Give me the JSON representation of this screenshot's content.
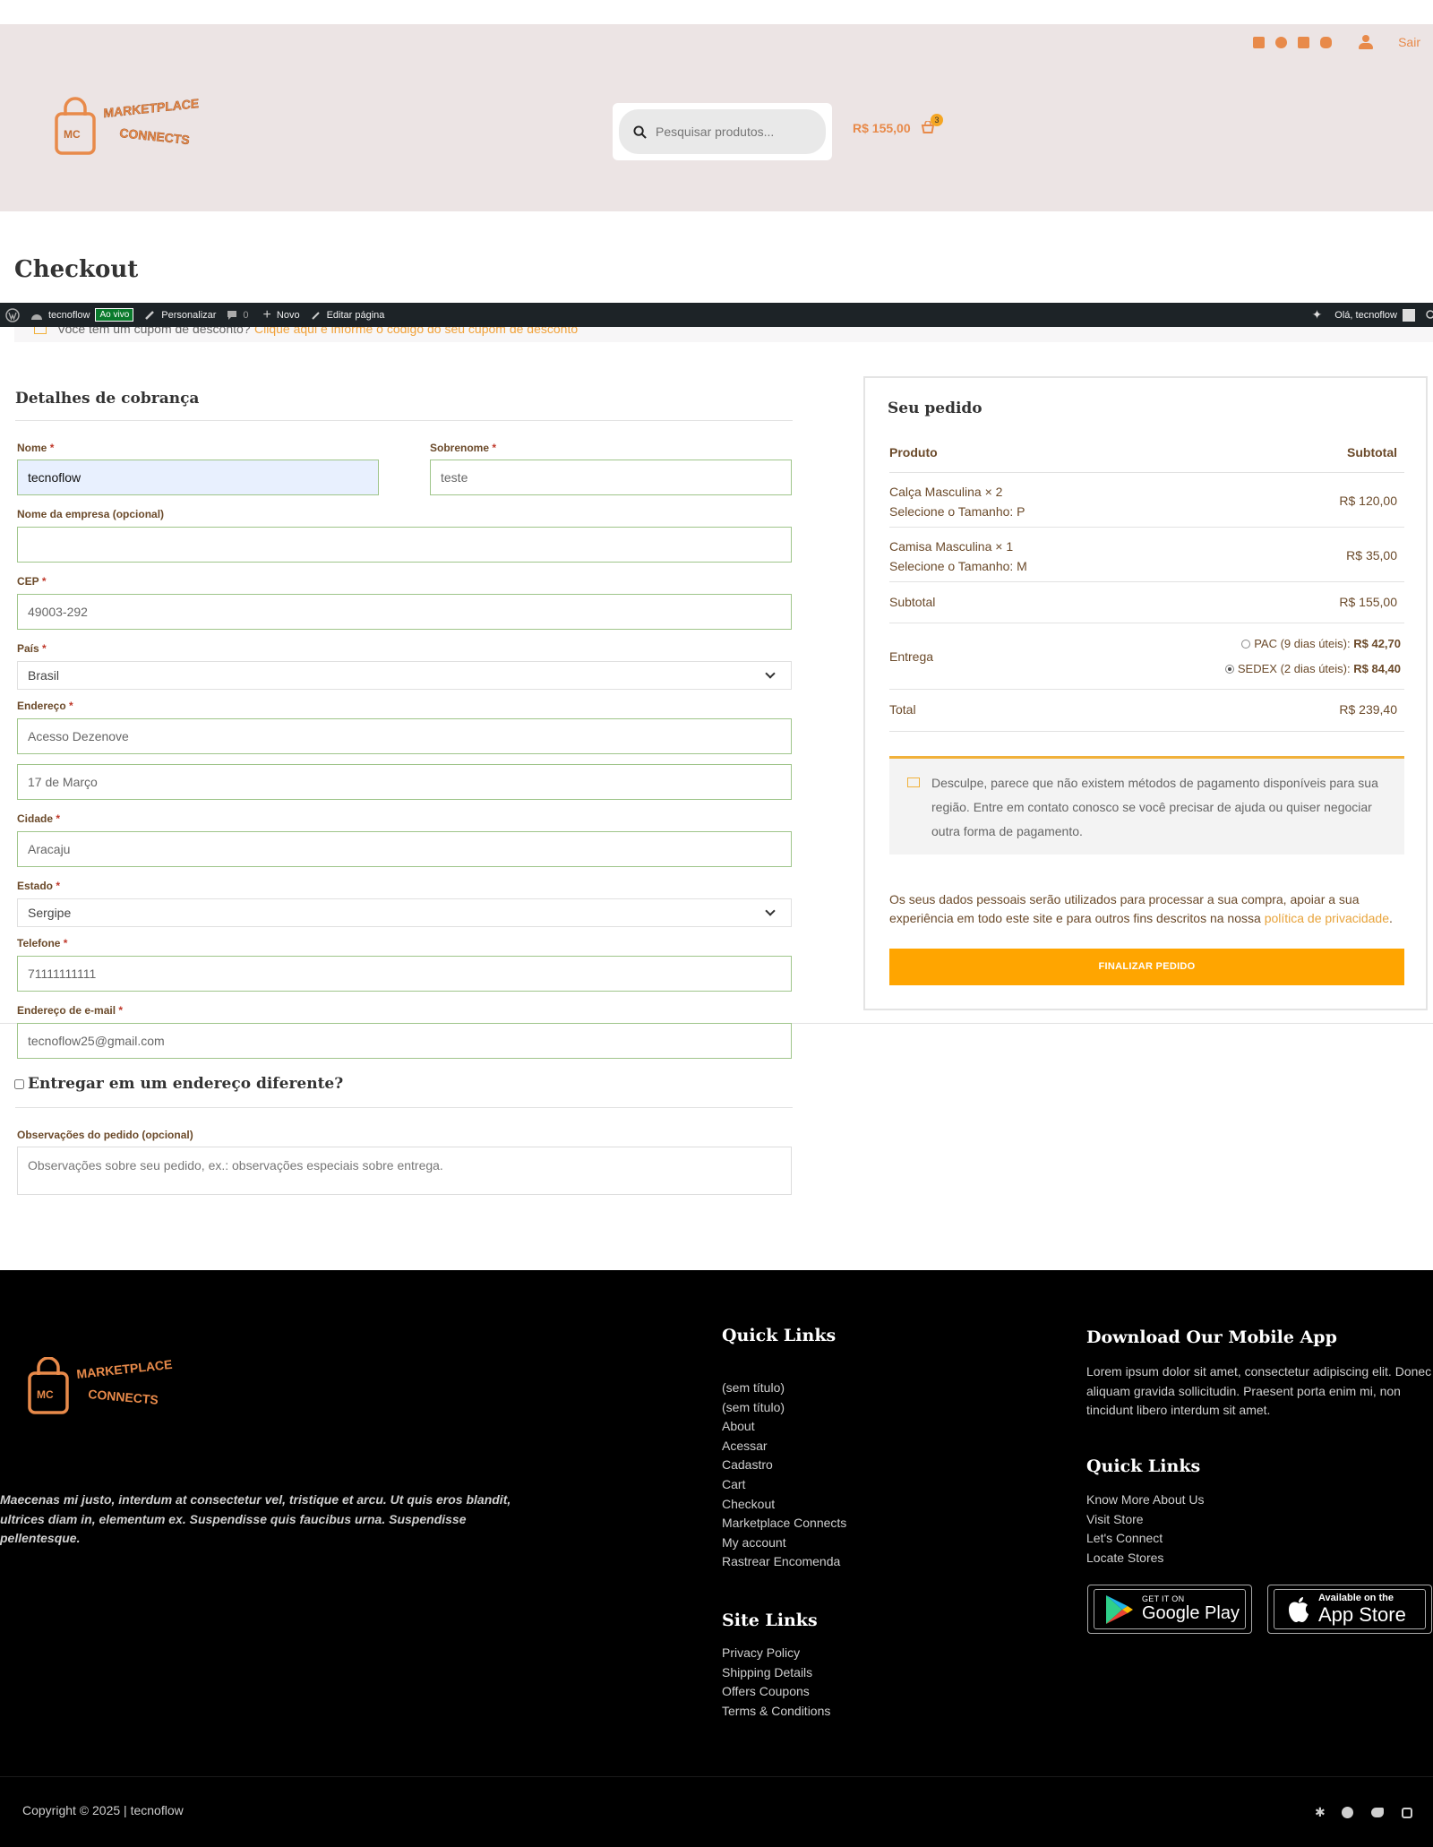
{
  "header": {
    "logout": "Sair",
    "search_placeholder": "Pesquisar produtos...",
    "cart_total": "R$ 155,00",
    "cart_count": "3",
    "logo_line1": "MARKETPLACE",
    "logo_line2": "CONNECTS",
    "logo_mark": "MC"
  },
  "page_title": "Checkout",
  "admin_bar": {
    "site": "tecnoflow",
    "live": "Ao vivo",
    "customize": "Personalizar",
    "comments": "0",
    "new": "Novo",
    "edit": "Editar página",
    "greeting": "Olá, tecnoflow"
  },
  "coupon": {
    "text": "Você tem um cupom de desconto?",
    "link": "Clique aqui e informe o código do seu cupom de desconto"
  },
  "billing": {
    "title": "Detalhes de cobrança",
    "required": "*",
    "first_name_label": "Nome",
    "first_name": "tecnoflow",
    "last_name_label": "Sobrenome",
    "last_name": "teste",
    "company_label": "Nome da empresa (opcional)",
    "company": "",
    "cep_label": "CEP",
    "cep": "49003-292",
    "country_label": "País",
    "country": "Brasil",
    "address_label": "Endereço",
    "address1": "Acesso Dezenove",
    "address2": "17 de Março",
    "city_label": "Cidade",
    "city": "Aracaju",
    "state_label": "Estado",
    "state": "Sergipe",
    "phone_label": "Telefone",
    "phone": "71111111111",
    "email_label": "Endereço de e-mail",
    "email": "tecnoflow25@gmail.com",
    "ship_different": "Entregar em um endereço diferente?",
    "notes_label": "Observações do pedido (opcional)",
    "notes_placeholder": "Observações sobre seu pedido, ex.: observações especiais sobre entrega."
  },
  "order": {
    "title": "Seu pedido",
    "col_product": "Produto",
    "col_subtotal": "Subtotal",
    "items": [
      {
        "name": "Calça Masculina",
        "qty": "× 2",
        "variant": "Selecione o Tamanho: P",
        "total": "R$ 120,00"
      },
      {
        "name": "Camisa Masculina",
        "qty": "× 1",
        "variant": "Selecione o Tamanho: M",
        "total": "R$ 35,00"
      }
    ],
    "subtotal_label": "Subtotal",
    "subtotal": "R$ 155,00",
    "shipping_label": "Entrega",
    "shipping_pac_label": "PAC (9 dias úteis):",
    "shipping_pac_price": "R$ 42,70",
    "shipping_sedex_label": "SEDEX (2 dias úteis):",
    "shipping_sedex_price": "R$ 84,40",
    "shipping_selected": "SEDEX",
    "total_label": "Total",
    "total": "R$ 239,40",
    "notice": "Desculpe, parece que não existem métodos de pagamento disponíveis para sua região. Entre em contato conosco se você precisar de ajuda ou quiser negociar outra forma de pagamento.",
    "privacy_text": "Os seus dados pessoais serão utilizados para processar a sua compra, apoiar a sua experiência em todo este site e para outros fins descritos na nossa",
    "privacy_link": "política de privacidade",
    "privacy_end": ".",
    "place_order": "FINALIZAR PEDIDO"
  },
  "footer": {
    "tagline": "Maecenas mi justo, interdum at consectetur vel, tristique et arcu. Ut quis eros blandit, ultrices diam in, elementum ex. Suspendisse quis faucibus urna. Suspendisse pellentesque.",
    "quick_links_title": "Quick Links",
    "quick_links": [
      "(sem título)",
      "(sem título)",
      "About",
      "Acessar",
      "Cadastro",
      "Cart",
      "Checkout",
      "Marketplace Connects",
      "My account",
      "Rastrear Encomenda"
    ],
    "site_links_title": "Site Links",
    "site_links": [
      "Privacy Policy",
      "Shipping Details",
      "Offers Coupons",
      "Terms & Conditions"
    ],
    "app_title": "Download Our Mobile App",
    "app_text": "Lorem ipsum dolor sit amet, consectetur adipiscing elit. Donec aliquam gravida sollicitudin. Praesent porta enim mi, non tincidunt libero interdum sit amet.",
    "quick_links2_title": "Quick Links",
    "quick_links2": [
      "Know More About Us",
      "Visit Store",
      "Let's Connect",
      "Locate Stores"
    ],
    "google_top": "GET IT ON",
    "google_bottom": "Google Play",
    "apple_top": "Available on the",
    "apple_bottom": "App Store",
    "copyright": "Copyright © 2025 | tecnoflow"
  },
  "colors": {
    "accent": "#ffa500",
    "brand": "#e88a4a",
    "header_bg": "#ece4e4",
    "admin_bar": "#1d2327",
    "footer_bg": "#000000"
  }
}
